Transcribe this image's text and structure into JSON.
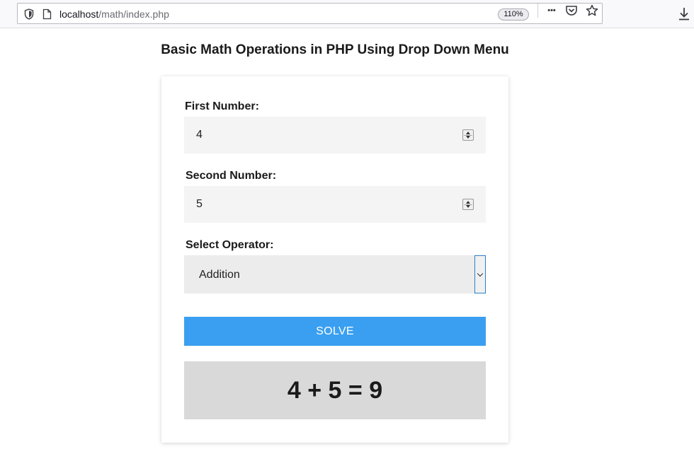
{
  "browser": {
    "url_host": "localhost",
    "url_path": "/math/index.php",
    "zoom": "110%",
    "more_glyph": "•••"
  },
  "page": {
    "title": "Basic Math Operations in PHP Using Drop Down Menu"
  },
  "form": {
    "first_label": "First Number:",
    "first_value": "4",
    "second_label": "Second Number:",
    "second_value": "5",
    "operator_label": "Select Operator:",
    "operator_selected": "Addition",
    "solve_label": "SOLVE",
    "result": "4 + 5 = 9"
  },
  "colors": {
    "solve_button": "#3a9ff0",
    "result_bg": "#d9d9d9",
    "select_focus_border": "#2a7fd0"
  }
}
